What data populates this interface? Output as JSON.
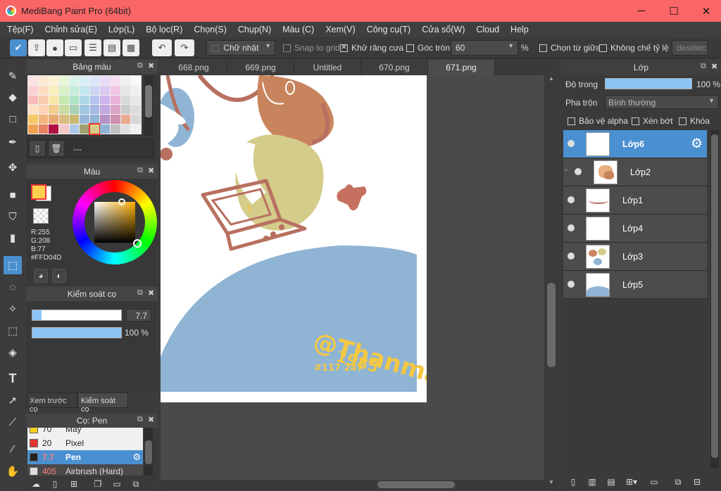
{
  "window": {
    "title": "MediBang Paint Pro (64bit)",
    "minimize": "─",
    "maximize": "☐",
    "close": "✕"
  },
  "menu": [
    "Tệp(F)",
    "Chỉnh sửa(E)",
    "Lớp(L)",
    "Bộ lọc(R)",
    "Chọn(S)",
    "Chụp(N)",
    "Màu (C)",
    "Xem(V)",
    "Công cụ(T)",
    "Cửa sổ(W)",
    "Cloud",
    "Help"
  ],
  "toolbar": {
    "selection_shape": "Chữ nhật",
    "snap_to_grid": "Snap to grid",
    "antialias": "Khử răng cưa",
    "round_corner": "Góc tròn",
    "corner_value": "60",
    "percent": "%",
    "select_from_center": "Chọn từ giữa",
    "constrain_ratio": "Không chế tỷ lệ",
    "deselect": "deselec"
  },
  "palette_panel": {
    "title": "Bảng màu",
    "set_name": "---"
  },
  "color_panel": {
    "title": "Màu",
    "r": "R:255",
    "g": "G:208",
    "b": "B:77",
    "hex": "#FFD04D",
    "primary_color": "#FFD04D"
  },
  "brush_control": {
    "title": "Kiểm soát cọ",
    "size_value": "7.7",
    "size_fraction": 0.1,
    "opacity_value": "100 %",
    "opacity_fraction": 1.0
  },
  "bottom_tabs": {
    "preview": "Xem trước cọ",
    "control": "Kiểm soát cọ"
  },
  "brush_panel": {
    "title": "Cọ: Pen",
    "items": [
      {
        "num": "70",
        "name": "Mây",
        "color": "#f5d020"
      },
      {
        "num": "20",
        "name": "Pixel",
        "color": "#e33333"
      },
      {
        "num": "7.7",
        "name": "Pen",
        "color": "#222222"
      },
      {
        "num": "405",
        "name": "Airbrush (Hard)",
        "color": "#dddddd"
      }
    ]
  },
  "tabs": [
    "668.png",
    "669.png",
    "Untitled",
    "670.png",
    "671.png"
  ],
  "canvas": {
    "signature_name": "@Thanma",
    "signature_year": "1985",
    "signature_tag": "#117 247"
  },
  "layer_panel": {
    "title": "Lớp",
    "opacity_label": "Độ trong",
    "opacity_value": "100 %",
    "opacity_fraction": 1.0,
    "blend_label": "Pha trộn",
    "blend_value": "Bình thường",
    "protect_alpha": "Bảo vệ alpha",
    "clipping": "Xén bớt",
    "lock": "Khóa",
    "layers": [
      {
        "name": "Lớp6",
        "selected": true
      },
      {
        "name": "Lớp2",
        "selected": false
      },
      {
        "name": "Lớp1",
        "selected": false
      },
      {
        "name": "Lớp4",
        "selected": false
      },
      {
        "name": "Lớp3",
        "selected": false
      },
      {
        "name": "Lớp5",
        "selected": false
      }
    ]
  },
  "colors": {
    "accent": "#4a90d0",
    "titlebar": "#fa6666",
    "canvas_blue": "#8fb4d4",
    "olive": "#d4cc8a",
    "brown": "#b87060",
    "signature": "#f5c842"
  }
}
